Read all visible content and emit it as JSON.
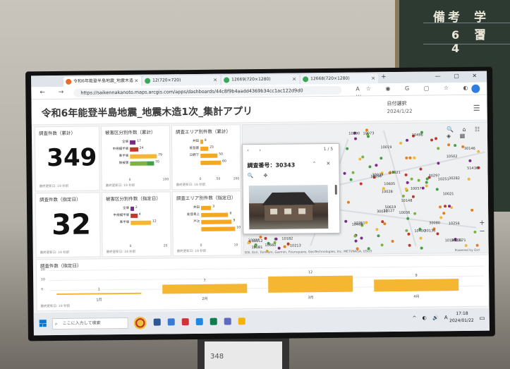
{
  "chalkboard": {
    "col1": "備考",
    "col2": "学 習",
    "row": "6 5 4"
  },
  "browser": {
    "tabs": [
      {
        "title": "令和6年能登半島地震_地震木造",
        "color": "#e86d2b"
      },
      {
        "title": "12(720×720)",
        "color": "#3aa757"
      },
      {
        "title": "12669(720×1280)",
        "color": "#3aa757"
      },
      {
        "title": "12668(720×1280)",
        "color": "#3aa757"
      }
    ],
    "new_tab": "+",
    "window_controls": "— ▢ ✕",
    "nav": "← → C",
    "url": "https://saikennakanoto.maps.arcgis.com/apps/dashboards/44c8f9b4aadd4369b34cc1ac122d9d0",
    "toolbar_icons": "A☆ ◉ G ▢ ☆ ◐ ⋯"
  },
  "app": {
    "title": "令和6年能登半島地震_地震木造1次_集計アプリ",
    "date_label": "日付選択",
    "date_value": "2024/1/22"
  },
  "kpi_total": {
    "title": "調査件数（累計）",
    "value": "349",
    "footer": "最終更新日: 19 秒前"
  },
  "kpi_day": {
    "title": "調査件数（指定日）",
    "value": "32",
    "footer": "最終更新日: 19 秒前"
  },
  "ken_total": {
    "title": "被害区分別件数（累計）",
    "rows": [
      {
        "label": "全壊",
        "segments": [
          {
            "v": 17,
            "c": "#7b2a8a"
          }
        ],
        "total": "17"
      },
      {
        "label": "中規模半壊",
        "segments": [
          {
            "v": 24,
            "c": "#c0392b"
          }
        ],
        "total": "24"
      },
      {
        "label": "準半壊",
        "segments": [
          {
            "v": 79,
            "c": "#f5b731"
          }
        ],
        "total": "79"
      },
      {
        "label": "無被害",
        "segments": [
          {
            "v": 50,
            "c": "#7cb342"
          },
          {
            "v": 20,
            "c": "#43a047"
          }
        ],
        "total": "70"
      }
    ],
    "axis": [
      "0",
      "100"
    ],
    "footer": "最終更新日: 19 秒前"
  },
  "ken_day": {
    "title": "被害区分別件数（指定日）",
    "rows": [
      {
        "label": "全壊",
        "segments": [
          {
            "v": 2,
            "c": "#7b2a8a"
          }
        ],
        "total": "2"
      },
      {
        "label": "中規模半壊",
        "segments": [
          {
            "v": 4,
            "c": "#c0392b"
          }
        ],
        "total": "4"
      },
      {
        "label": "準半壊",
        "segments": [
          {
            "v": 12,
            "c": "#f5b731"
          }
        ],
        "total": "12"
      }
    ],
    "axis": [
      "0",
      "20"
    ],
    "footer": "最終更新日: 19 秒前"
  },
  "area_total": {
    "title": "調査エリア別件数（累計）",
    "rows": [
      {
        "label": "井田",
        "value": 8,
        "text": "8"
      },
      {
        "label": "能登鹿",
        "value": 23,
        "text": "23"
      },
      {
        "label": "日野下",
        "value": 50,
        "text": "50"
      },
      {
        "label": "",
        "value": 60,
        "text": "60"
      }
    ],
    "axis": [
      "0",
      "50",
      "100"
    ],
    "footer": "最終更新日: 19 秒前"
  },
  "area_day": {
    "title": "調査エリア別件数（指定日）",
    "rows": [
      {
        "label": "井田",
        "value": 3,
        "text": "3"
      },
      {
        "label": "能登島上",
        "value": 8,
        "text": "8"
      },
      {
        "label": "戸次",
        "value": 9,
        "text": "9"
      },
      {
        "label": "",
        "value": 10,
        "text": "10"
      }
    ],
    "axis": [
      "0",
      "10"
    ],
    "footer": "最終更新日: 19 秒前"
  },
  "map": {
    "popup": {
      "nav": "‹ ›",
      "count": "1 / 5",
      "title": "調査番号：30343",
      "buttons": "⌃ ✕",
      "tools": "🔍 ✥"
    },
    "labels": [
      "10148",
      "10158",
      "10073",
      "10021",
      "10171",
      "10019",
      "10036",
      "10028",
      "10127",
      "10251",
      "30282",
      "10496",
      "10290",
      "10189",
      "10605",
      "30080",
      "10057",
      "51436",
      "30146",
      "10821",
      "30231",
      "30039",
      "30136",
      "30031",
      "10256",
      "30297",
      "10400",
      "10261",
      "10502",
      "10408",
      "50619",
      "10660",
      "10081",
      "10213",
      "10182",
      "10337",
      "10312"
    ],
    "tools": "🔍 ⌂ ☷ ◈ ▦",
    "zoom": "+ −",
    "attribution": "GSI, Esri, TomTom, Garmin, Foursquare, GeoTechnologies, Inc, METI/NASA, USGS",
    "powered": "Powered by Esri"
  },
  "bottom_chart": {
    "title": "調査件数（指定日）",
    "yticks": [
      "20",
      "10",
      "0"
    ],
    "footer": "最終更新日: 19 秒前"
  },
  "chart_data": {
    "type": "bar",
    "categories": [
      "1月",
      "2月",
      "3月",
      "4月"
    ],
    "values": [
      1,
      7,
      12,
      9
    ],
    "title": "調査件数（指定日）",
    "ylim": [
      0,
      20
    ]
  },
  "taskbar": {
    "search_placeholder": "ここに入力して検索",
    "tray": "^ ◐ 🔊 A",
    "time": "17:18",
    "date": "2024/01/22"
  },
  "stand_text": "348"
}
